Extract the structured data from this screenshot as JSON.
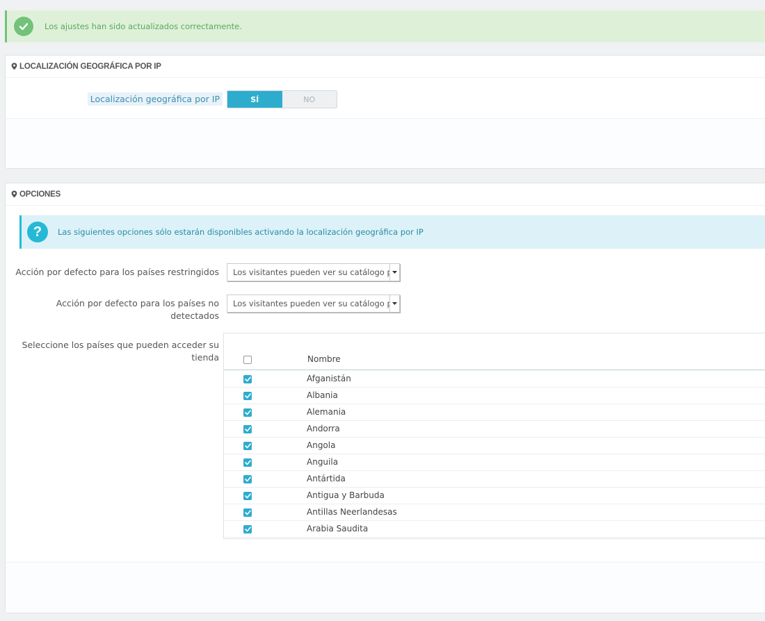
{
  "alerts": {
    "success_message": "Los ajustes han sido actualizados correctamente.",
    "info_message": "Las siguientes opciones sólo estarán disponibles activando la localización geográfica por IP"
  },
  "geolocation_panel": {
    "title": "LOCALIZACIÓN GEOGRÁFICA POR IP",
    "field_label": "Localización geográfica por IP",
    "switch_yes": "SÍ",
    "switch_no": "NO",
    "selected": "SÍ"
  },
  "options_panel": {
    "title": "OPCIONES",
    "restricted_label": "Acción por defecto para los países restringidos",
    "restricted_value": "Los visitantes pueden ver su catálogo p",
    "undetected_label_line1": "Acción por defecto para los países no",
    "undetected_label_line2": "detectados",
    "undetected_value": "Los visitantes pueden ver su catálogo p",
    "countries_label_line1": "Seleccione los países que pueden acceder su",
    "countries_label_line2": "tienda",
    "table": {
      "column_name": "Nombre",
      "rows": [
        {
          "name": "Afganistán",
          "checked": true
        },
        {
          "name": "Albania",
          "checked": true
        },
        {
          "name": "Alemania",
          "checked": true
        },
        {
          "name": "Andorra",
          "checked": true
        },
        {
          "name": "Angola",
          "checked": true
        },
        {
          "name": "Anguila",
          "checked": true
        },
        {
          "name": "Antártida",
          "checked": true
        },
        {
          "name": "Antigua y Barbuda",
          "checked": true
        },
        {
          "name": "Antillas Neerlandesas",
          "checked": true
        },
        {
          "name": "Arabia Saudita",
          "checked": true
        }
      ]
    }
  },
  "icons": {
    "success": "check-circle-icon",
    "info": "question-circle-icon",
    "panel": "map-marker-icon",
    "select": "caret-down-icon"
  },
  "colors": {
    "success_bg": "#dff0d8",
    "success_accent": "#72c279",
    "info_bg": "#dcf2f8",
    "info_accent": "#25b9d7",
    "switch_on": "#2eacce"
  }
}
